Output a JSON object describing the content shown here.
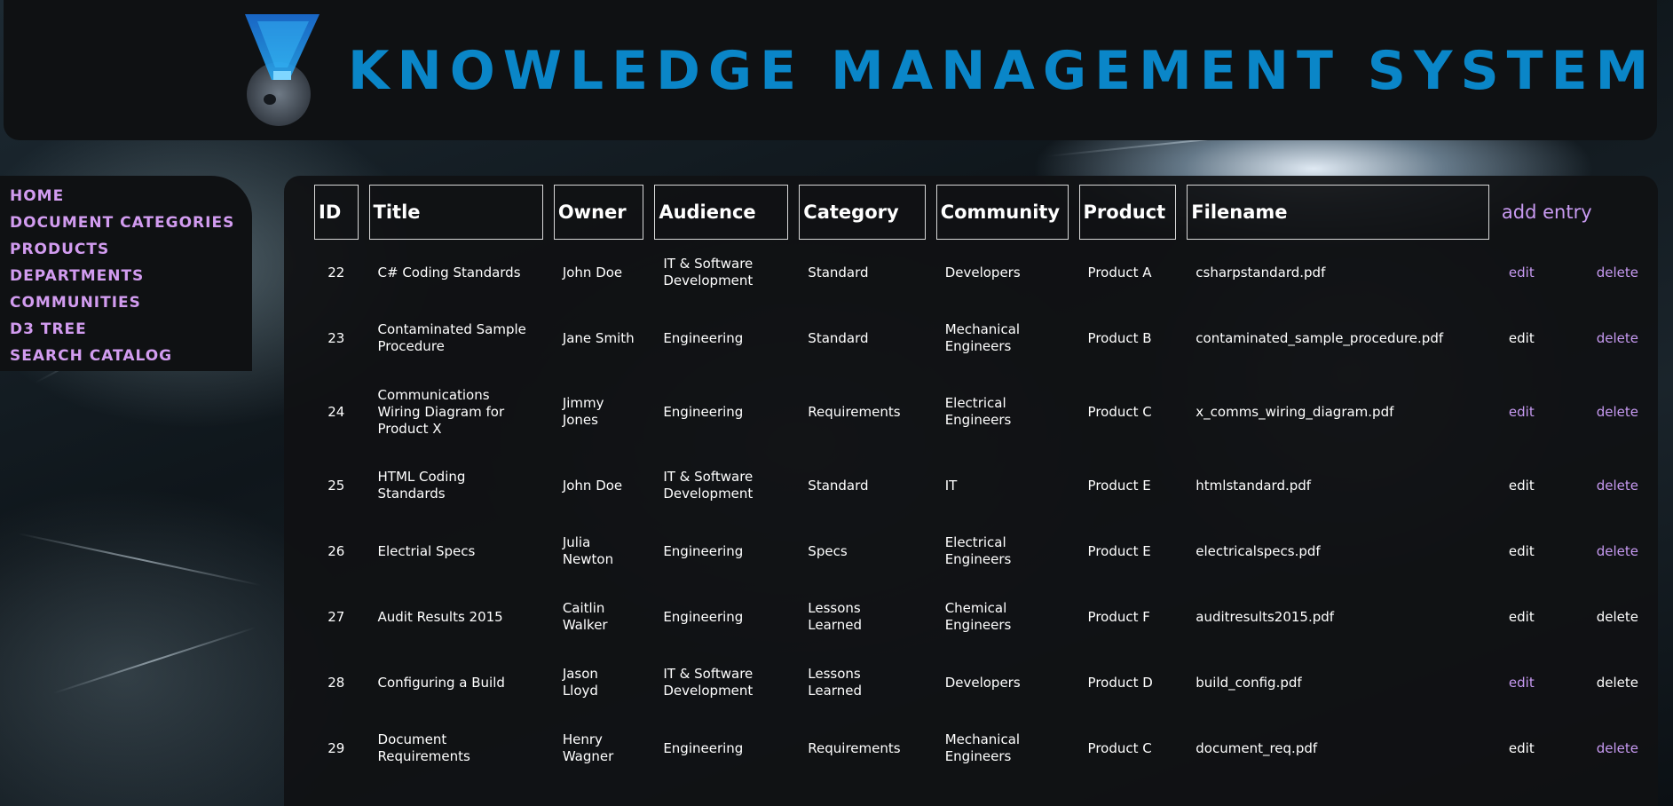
{
  "header": {
    "title": "KNOWLEDGE MANAGEMENT SYSTEM",
    "logo_icon": "crystal-skull-logo-icon"
  },
  "sidebar": {
    "items": [
      {
        "label": "HOME"
      },
      {
        "label": "DOCUMENT CATEGORIES"
      },
      {
        "label": "PRODUCTS"
      },
      {
        "label": "DEPARTMENTS"
      },
      {
        "label": "COMMUNITIES"
      },
      {
        "label": "D3 TREE"
      },
      {
        "label": "SEARCH CATALOG"
      }
    ]
  },
  "table": {
    "columns": [
      "ID",
      "Title",
      "Owner",
      "Audience",
      "Category",
      "Community",
      "Product",
      "Filename"
    ],
    "add_entry_label": "add entry",
    "edit_label": "edit",
    "delete_label": "delete",
    "rows": [
      {
        "id": "22",
        "title": "C# Coding Standards",
        "owner": "John Doe",
        "audience": "IT & Software Development",
        "category": "Standard",
        "community": "Developers",
        "product": "Product A",
        "filename": "csharpstandard.pdf"
      },
      {
        "id": "23",
        "title": "Contaminated Sample Procedure",
        "owner": "Jane Smith",
        "audience": "Engineering",
        "category": "Standard",
        "community": "Mechanical Engineers",
        "product": "Product B",
        "filename": "contaminated_sample_procedure.pdf"
      },
      {
        "id": "24",
        "title": "Communications Wiring Diagram for Product X",
        "owner": "Jimmy Jones",
        "audience": "Engineering",
        "category": "Requirements",
        "community": "Electrical Engineers",
        "product": "Product C",
        "filename": "x_comms_wiring_diagram.pdf"
      },
      {
        "id": "25",
        "title": "HTML Coding Standards",
        "owner": "John Doe",
        "audience": "IT & Software Development",
        "category": "Standard",
        "community": "IT",
        "product": "Product E",
        "filename": "htmlstandard.pdf"
      },
      {
        "id": "26",
        "title": "Electrial Specs",
        "owner": "Julia Newton",
        "audience": "Engineering",
        "category": "Specs",
        "community": "Electrical Engineers",
        "product": "Product E",
        "filename": "electricalspecs.pdf"
      },
      {
        "id": "27",
        "title": "Audit Results 2015",
        "owner": "Caitlin Walker",
        "audience": "Engineering",
        "category": "Lessons Learned",
        "community": "Chemical Engineers",
        "product": "Product F",
        "filename": "auditresults2015.pdf"
      },
      {
        "id": "28",
        "title": "Configuring a Build",
        "owner": "Jason Lloyd",
        "audience": "IT & Software Development",
        "category": "Lessons Learned",
        "community": "Developers",
        "product": "Product D",
        "filename": "build_config.pdf"
      },
      {
        "id": "29",
        "title": "Document Requirements",
        "owner": "Henry Wagner",
        "audience": "Engineering",
        "category": "Requirements",
        "community": "Mechanical Engineers",
        "product": "Product C",
        "filename": "document_req.pdf"
      }
    ]
  },
  "colors": {
    "title_blue": "#0a86c8",
    "nav_purple": "#d29cf0",
    "link_purple": "#c79af2",
    "panel": "#0f1113"
  }
}
